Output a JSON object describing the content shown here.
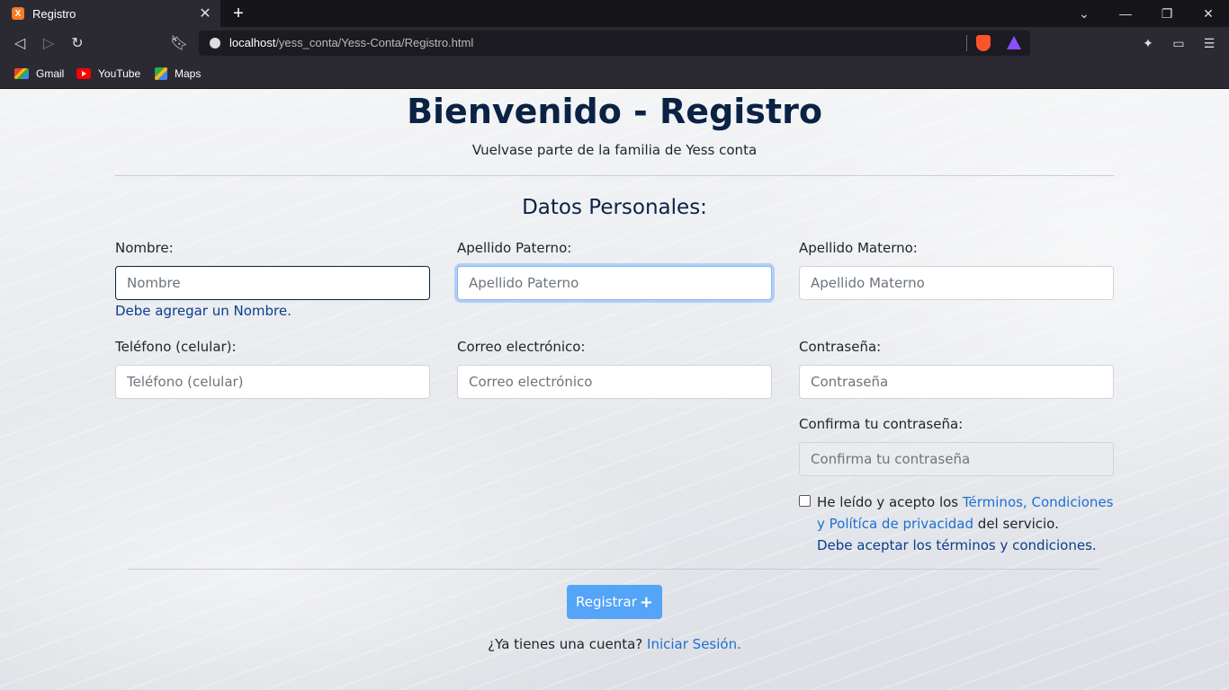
{
  "browser": {
    "tab_title": "Registro",
    "favicon_text": "X",
    "url_host": "localhost",
    "url_path": "/yess_conta/Yess-Conta/Registro.html",
    "bookmarks": [
      "Gmail",
      "YouTube",
      "Maps"
    ]
  },
  "page": {
    "title": "Bienvenido - Registro",
    "subtitle": "Vuelvase parte de la familia de Yess conta",
    "section_title": "Datos Personales:"
  },
  "form": {
    "nombre_label": "Nombre:",
    "nombre_placeholder": "Nombre",
    "nombre_feedback": "Debe agregar un Nombre.",
    "apellido_paterno_label": "Apellido Paterno:",
    "apellido_paterno_placeholder": "Apellido Paterno",
    "apellido_materno_label": "Apellido Materno:",
    "apellido_materno_placeholder": "Apellido Materno",
    "telefono_label": "Teléfono (celular):",
    "telefono_placeholder": "Teléfono (celular)",
    "correo_label": "Correo electrónico:",
    "correo_placeholder": "Correo electrónico",
    "contrasena_label": "Contraseña:",
    "contrasena_placeholder": "Contraseña",
    "confirma_label": "Confirma tu contraseña:",
    "confirma_placeholder": "Confirma tu contraseña",
    "terms_prefix": "He leído y acepto los ",
    "terms_link": "Términos, Condiciones y Polítíca de privacidad",
    "terms_suffix": " del servicio.",
    "terms_feedback": "Debe aceptar los términos y condiciones.",
    "register_button": "Registrar",
    "login_prompt": "¿Ya tienes una cuenta? ",
    "login_link": "Iniciar Sesión."
  }
}
